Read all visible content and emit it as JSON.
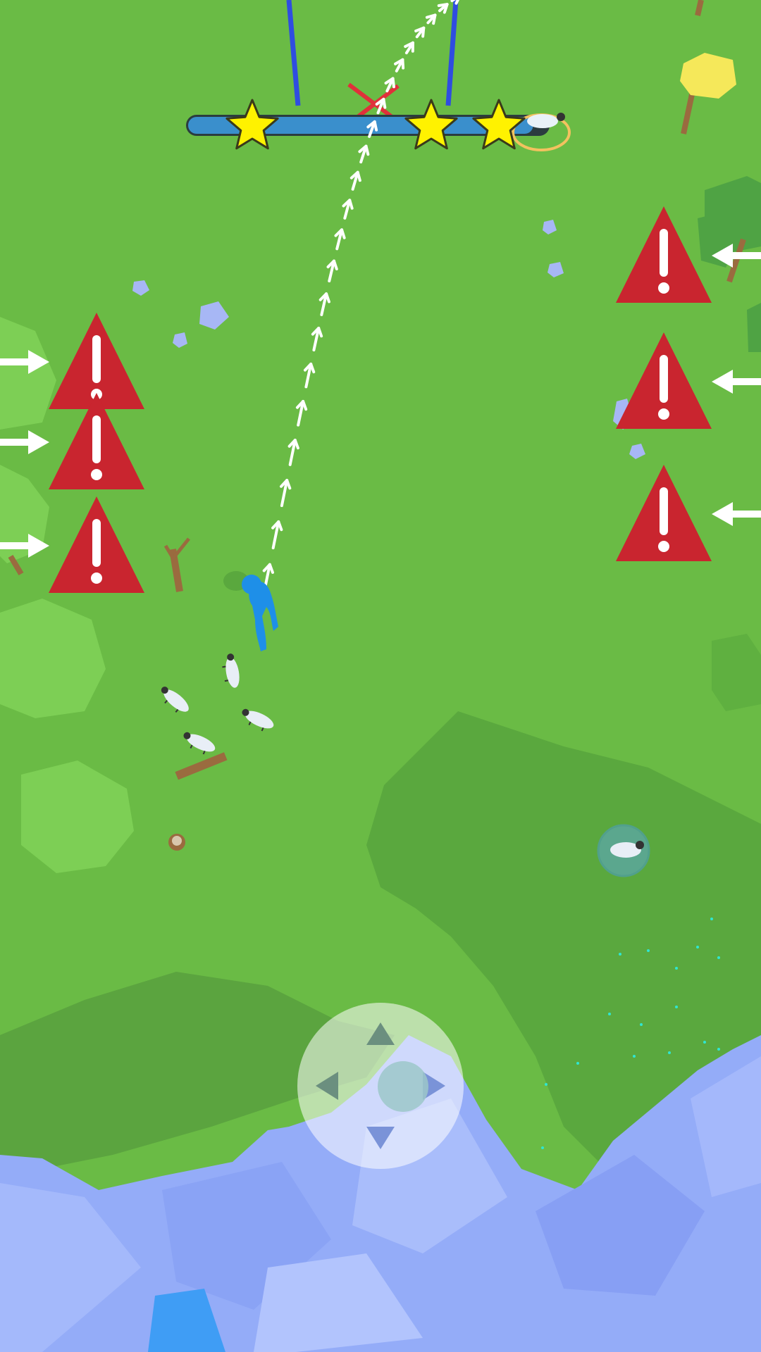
{
  "game": {
    "title": "",
    "colors": {
      "grass": "#6abb45",
      "grass_shadow": "#5aa83e",
      "water": "#94acf8",
      "player": "#1e8fe8",
      "warning": "#c9252f",
      "star": "#fff200",
      "progress_track": "#3a8fcc"
    }
  },
  "progress": {
    "stars_total": 3,
    "stars_earned": 3,
    "fraction": 0.96
  },
  "hazards": {
    "left_count": 3,
    "right_count": 3,
    "icon": "warning-triangle-icon",
    "arrow_icon": "arrow-icon"
  },
  "player": {
    "icon": "stickman-icon",
    "color": "#1e8fe8"
  },
  "flock": {
    "following": 4,
    "stray_in_bubble": 1,
    "in_goal": 1
  },
  "path": {
    "icon": "dashed-arrow-path"
  },
  "joystick": {
    "icons": [
      "arrow-up-icon",
      "arrow-down-icon",
      "arrow-left-icon",
      "arrow-right-icon",
      "knob"
    ]
  }
}
